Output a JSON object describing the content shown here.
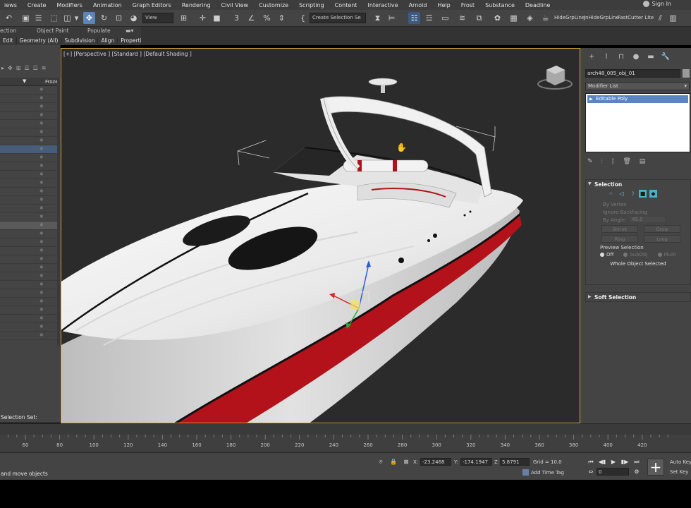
{
  "menu": [
    "iews",
    "Create",
    "Modifiers",
    "Animation",
    "Graph Editors",
    "Rendering",
    "Civil View",
    "Customize",
    "Scripting",
    "Content",
    "Interactive",
    "Arnold",
    "Help",
    "Frost",
    "Substance",
    "Deadline"
  ],
  "signin": "Sign In",
  "toolbar": {
    "view_dropdown": "View",
    "selection_set": "Create Selection Se",
    "right_text": "HideGrpLine",
    "right_text2": "JnHideGrpLine",
    "right_text3": "FastCutter Lite"
  },
  "ribbon": {
    "row1": [
      "ection",
      "Object Paint",
      "Populate"
    ],
    "row2": [
      "Edit",
      "Geometry (All)",
      "Subdivision",
      "Align",
      "Properties"
    ]
  },
  "explorer": {
    "column_header": "Frozen",
    "selection_set_label": "Selection Set:"
  },
  "viewport": {
    "label": "[+] [Perspective ] [Standard ] [Default Shading ]"
  },
  "command_panel": {
    "object_name": "arch48_005_obj_01",
    "modifier_list": "Modifier List",
    "stack_item": "Editable Poly",
    "selection_rollout": {
      "title": "Selection",
      "by_vertex": "By Vertex",
      "ignore_backfacing": "Ignore Backfacing",
      "by_angle": "By Angle:",
      "angle_value": "45.0",
      "shrink": "Shrink",
      "grow": "Grow",
      "ring": "Ring",
      "loop": "Loop",
      "preview_selection": "Preview Selection",
      "off": "Off",
      "subobj": "SubObj",
      "multi": "Multi",
      "status": "Whole Object Selected"
    },
    "soft_selection_title": "Soft Selection"
  },
  "timeline": {
    "ticks": [
      60,
      80,
      100,
      120,
      140,
      160,
      180,
      200,
      220,
      240,
      260,
      280,
      300,
      320,
      340,
      360,
      380,
      400,
      420
    ]
  },
  "status": {
    "message": "and move objects",
    "x_label": "X:",
    "x_value": "-23.2468",
    "y_label": "Y:",
    "y_value": "-174.1947",
    "z_label": "Z:",
    "z_value": "5.8791",
    "grid": "Grid = 10.0",
    "add_time_tag": "Add Time Tag",
    "frame": "0",
    "auto_key": "Auto Key",
    "set_key": "Set Key"
  },
  "colors": {
    "viewport_border": "#d4a43a",
    "stack_highlight": "#5b84c4",
    "hull_white": "#efefef",
    "stripe_red": "#b3121b"
  }
}
